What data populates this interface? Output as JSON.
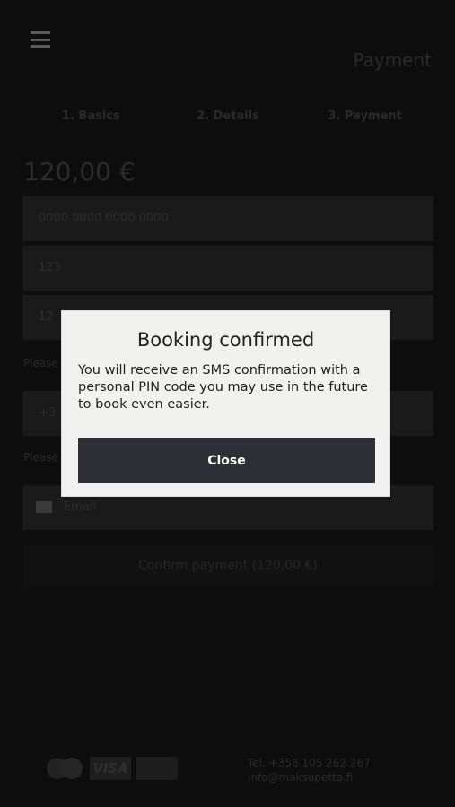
{
  "header": {
    "title": "Payment"
  },
  "steps": [
    "1. Basics",
    "2. Details",
    "3. Payment"
  ],
  "price": "120,00 €",
  "form": {
    "card_number_placeholder": "0000 0000 0000 0000",
    "cvc_placeholder": "123",
    "expiry_partial": "12",
    "hint_phone": "Please",
    "phone_prefix": "+3",
    "hint_email": "Please",
    "email_placeholder": "Email",
    "confirm_label": "Confirm payment (120,00 €)"
  },
  "footer": {
    "visa_label": "VISA",
    "phone": "Tel. +358 105 262 267",
    "email": "info@maksupetta.fi"
  },
  "dialog": {
    "title": "Booking confirmed",
    "message": "You will receive an SMS confirmation with a personal PIN code you may use in the future to book even easier.",
    "close_label": "Close"
  }
}
